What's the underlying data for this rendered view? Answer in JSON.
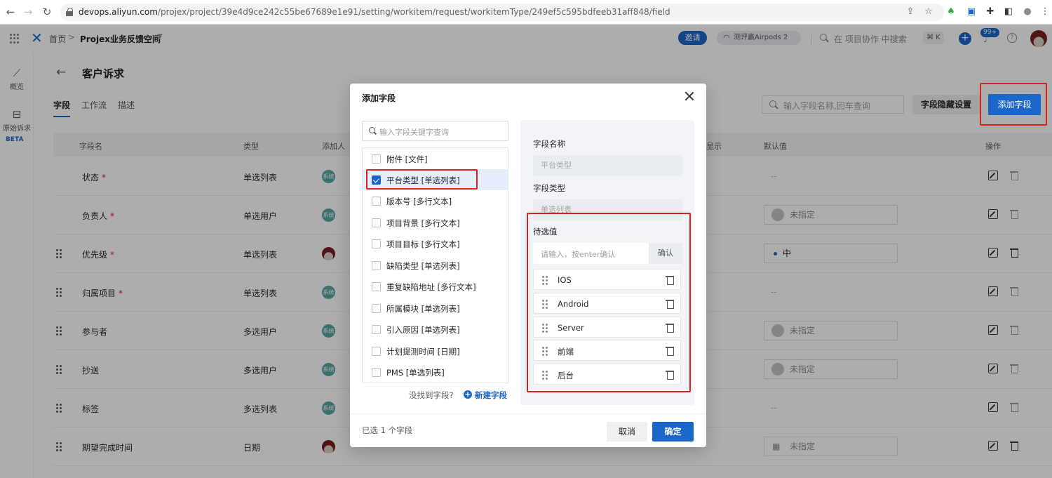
{
  "browser": {
    "url_host": "devops.aliyun.com",
    "url_path": "/projex/project/39e4d9ce242c55be67689e1e91/setting/workitem/request/workitemType/249ef5c595bdfeeb31aff848/field"
  },
  "header": {
    "home": "首页",
    "separator": ">",
    "project": "Projex业务反馈空间",
    "invite": "邀请",
    "promo": "测评赢Airpods 2",
    "search_placeholder": "在 项目协作 中搜索",
    "shortcut": "⌘ K",
    "notifications": "99+"
  },
  "rail": {
    "overview": "概览",
    "raw_requests": "原始诉求",
    "beta": "BETA"
  },
  "page": {
    "title": "客户诉求",
    "tabs": [
      "字段",
      "工作流",
      "描述"
    ],
    "search_placeholder": "输入字段名称,回车查询",
    "hide_settings": "字段隐藏设置",
    "add_field": "添加字段",
    "columns": {
      "name": "字段名",
      "type": "类型",
      "adder": "添加人",
      "display": "显示",
      "default": "默认值",
      "actions": "操作"
    },
    "rows": [
      {
        "name": "状态",
        "required": "*",
        "type": "单选列表",
        "adder": "系统",
        "default": "--"
      },
      {
        "name": "负责人",
        "required": "*",
        "type": "单选用户",
        "adder": "系统",
        "default": "未指定"
      },
      {
        "name": "优先级",
        "required": "*",
        "type": "单选列表",
        "adder": "",
        "default": "中"
      },
      {
        "name": "归属项目",
        "required": "*",
        "type": "单选列表",
        "adder": "系统",
        "default": "--"
      },
      {
        "name": "参与者",
        "required": "",
        "type": "多选用户",
        "adder": "系统",
        "default": "未指定"
      },
      {
        "name": "抄送",
        "required": "",
        "type": "多选用户",
        "adder": "系统",
        "default": "未指定"
      },
      {
        "name": "标签",
        "required": "",
        "type": "多选列表",
        "adder": "系统",
        "default": "--"
      },
      {
        "name": "期望完成时间",
        "required": "",
        "type": "日期",
        "adder": "",
        "default": "未指定"
      }
    ]
  },
  "modal": {
    "title": "添加字段",
    "search_placeholder": "输入字段关键字查询",
    "fields": [
      {
        "label": "附件 [文件]",
        "checked": false
      },
      {
        "label": "平台类型 [单选列表]",
        "checked": true
      },
      {
        "label": "版本号 [多行文本]",
        "checked": false
      },
      {
        "label": "项目背景 [多行文本]",
        "checked": false
      },
      {
        "label": "项目目标 [多行文本]",
        "checked": false
      },
      {
        "label": "缺陷类型 [单选列表]",
        "checked": false
      },
      {
        "label": "重复缺陷地址 [多行文本]",
        "checked": false
      },
      {
        "label": "所属模块 [单选列表]",
        "checked": false
      },
      {
        "label": "引入原因 [单选列表]",
        "checked": false
      },
      {
        "label": "计划提测时间 [日期]",
        "checked": false
      },
      {
        "label": "PMS [单选列表]",
        "checked": false
      }
    ],
    "not_found": "没找到字段?",
    "new_field": "新建字段",
    "field_name_label": "字段名称",
    "field_name_value": "平台类型",
    "field_type_label": "字段类型",
    "field_type_value": "单选列表",
    "options_label": "待选值",
    "options_placeholder": "请输入，按enter确认",
    "options_confirm": "确认",
    "options": [
      "IOS",
      "Android",
      "Server",
      "前端",
      "后台"
    ],
    "selected_count": "已选 1 个字段",
    "cancel": "取消",
    "ok": "确定"
  },
  "colors": {
    "accent": "#1b66c9",
    "highlight": "#e02020"
  }
}
